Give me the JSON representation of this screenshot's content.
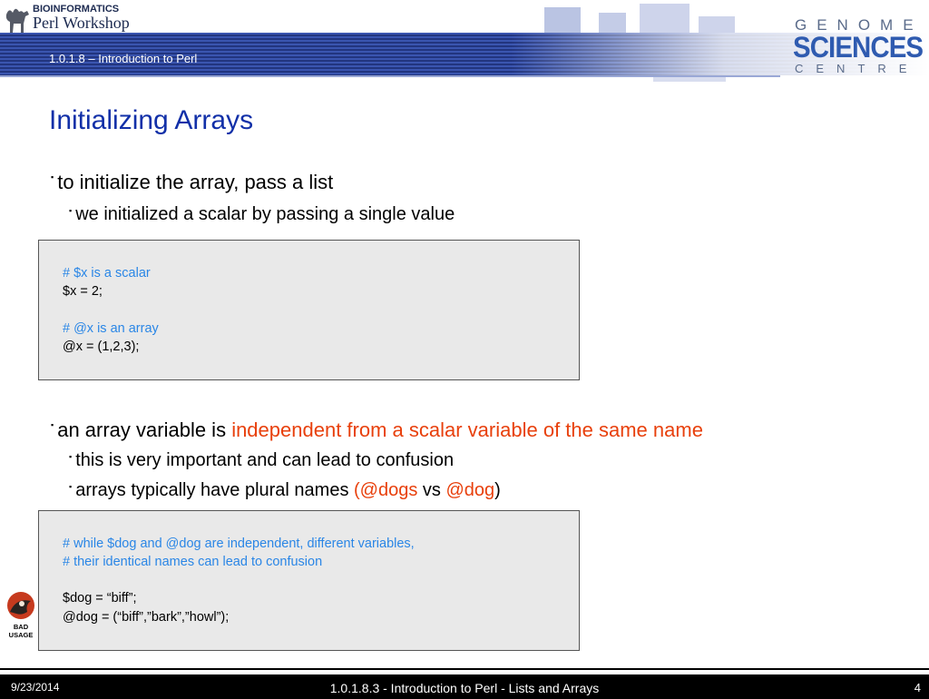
{
  "header": {
    "logo_line1": "BIOINFORMATICS",
    "logo_line2": "Perl Workshop",
    "caption": "1.0.1.8 – Introduction to Perl",
    "gsc_top": "GENOME",
    "gsc_mid": "SCIENCES",
    "gsc_bot": "CENTRE",
    "colors": {
      "band": "#2a3d8f",
      "band_dark": "#1d2a6e",
      "accent": "#2f5bb0"
    }
  },
  "slide": {
    "title": "Initializing Arrays",
    "bullet1": "to initialize the array, pass a list",
    "bullet1_sub1": "we initialized a scalar by passing a single value",
    "code1": [
      "# $x is a scalar",
      "$x = 2;",
      "# @x is an array",
      "@x = (1,2,3);"
    ],
    "bullet2_a": "an array variable is ",
    "bullet2_b": "independent from a scalar variable of the same name",
    "bullet2_sub1": "this is very important and can lead to confusion",
    "bullet2_sub2_a": "arrays typically have plural names ",
    "bullet2_sub2_b": "(@dogs",
    "bullet2_sub2_c": " vs ",
    "bullet2_sub2_d": "@dog",
    "bullet2_sub2_e": ")",
    "code2": [
      "# while $dog and @dog are independent, different variables,",
      "# their identical names can lead to confusion",
      "$dog = “biff”;",
      "@dog = (“biff”,”bark”,”howl”);"
    ],
    "bad_usage_label": "BAD USAGE",
    "colors": {
      "title": "#1230a8",
      "highlight": "#e8400c",
      "comment": "#2a86e6",
      "code_bg": "#e9e9e9"
    }
  },
  "footer": {
    "date": "9/23/2014",
    "title": "1.0.1.8.3 - Introduction to Perl - Lists and Arrays",
    "page": "4"
  }
}
